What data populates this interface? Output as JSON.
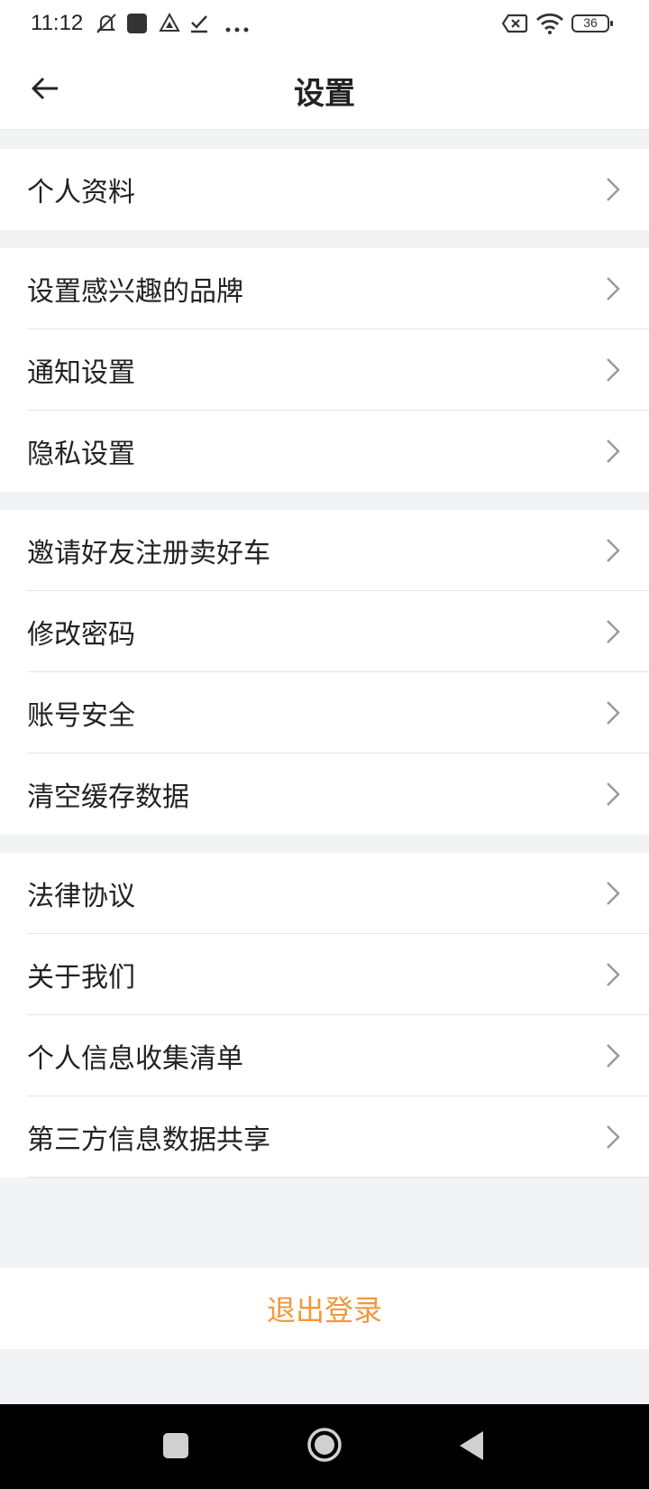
{
  "status_bar": {
    "time": "11:12",
    "battery": "36",
    "icons": [
      "mute-icon",
      "app-square-icon",
      "drive-icon",
      "check-icon",
      "more-icon",
      "sim-none-icon",
      "wifi-icon",
      "battery-icon"
    ]
  },
  "header": {
    "title": "设置",
    "back_icon": "arrow-left-icon"
  },
  "sections": [
    {
      "items": [
        {
          "label": "个人资料"
        }
      ]
    },
    {
      "items": [
        {
          "label": "设置感兴趣的品牌"
        },
        {
          "label": "通知设置"
        },
        {
          "label": "隐私设置"
        }
      ]
    },
    {
      "items": [
        {
          "label": "邀请好友注册卖好车"
        },
        {
          "label": "修改密码"
        },
        {
          "label": "账号安全"
        },
        {
          "label": "清空缓存数据"
        }
      ]
    },
    {
      "items": [
        {
          "label": "法律协议"
        },
        {
          "label": "关于我们"
        },
        {
          "label": "个人信息收集清单"
        },
        {
          "label": "第三方信息数据共享"
        }
      ]
    }
  ],
  "logout": {
    "label": "退出登录",
    "color": "#f0983c"
  },
  "colors": {
    "background": "#f2f3f5",
    "surface": "#ffffff",
    "accent": "#f0983c"
  }
}
